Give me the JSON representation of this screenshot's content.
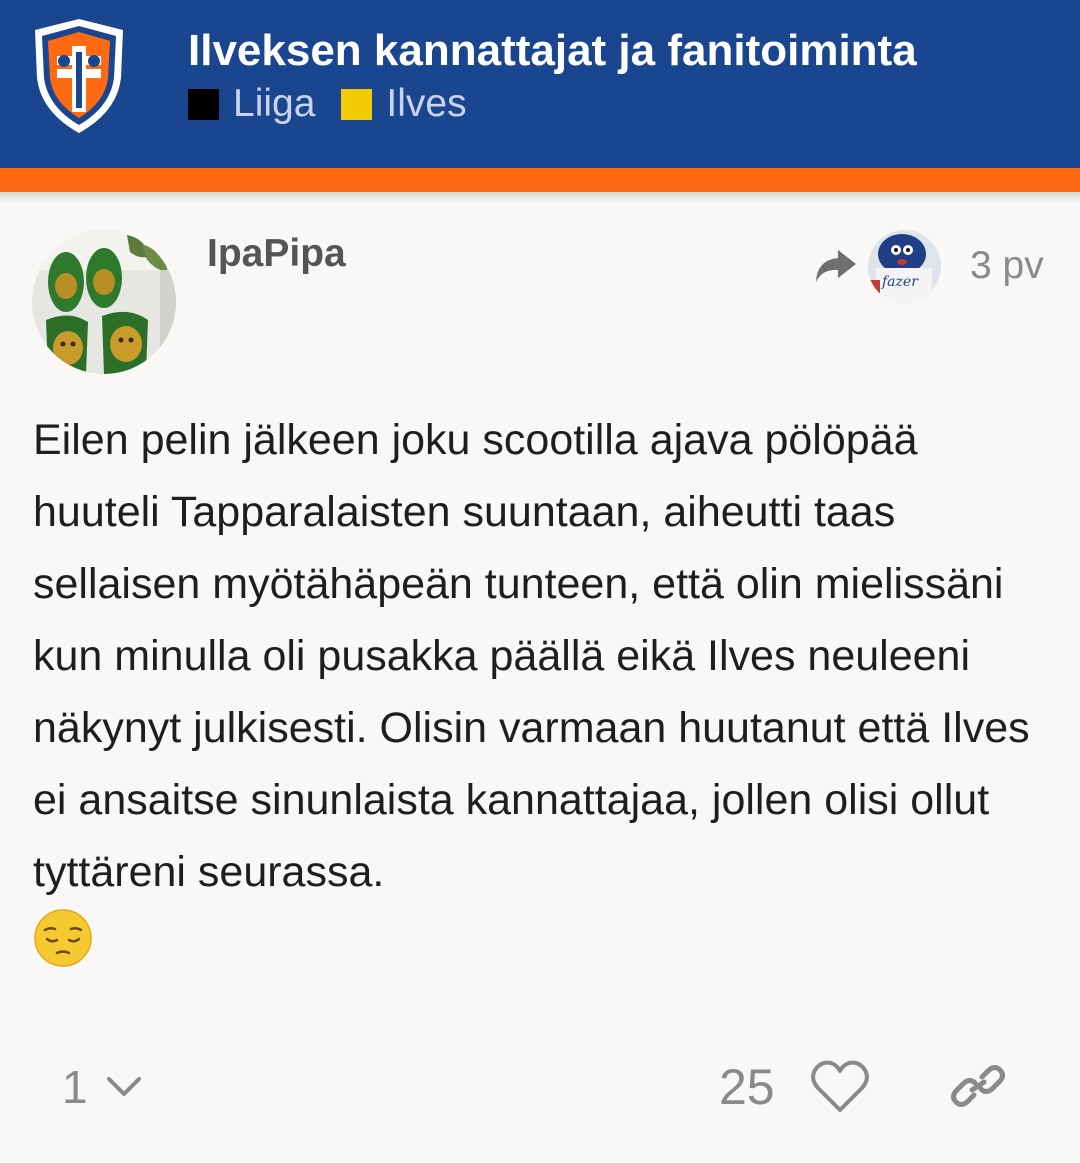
{
  "category": {
    "title": "Ilveksen kannattajat ja fanitoiminta",
    "logo_icon": "ilves-logo-icon",
    "colors": {
      "header": "#1a4690",
      "stripe": "#ff6a13"
    },
    "tags": [
      {
        "label": "Liiga",
        "color": "#000000"
      },
      {
        "label": "Ilves",
        "color": "#f3cb05"
      }
    ]
  },
  "post": {
    "username": "IpaPipa",
    "avatar_icon": "user-avatar",
    "reply_to_icon": "reply-arrow-icon",
    "reply_to_avatar": "reply-to-avatar",
    "age": "3 pv",
    "body": "Eilen pelin jälkeen joku scootilla ajava pölöpää huuteli Tapparalaisten suuntaan, aiheutti taas sellaisen myötähäpeän tunteen, että olin mielissäni kun minulla oli pusakka päällä eikä Ilves neuleeni näkynyt julkisesti. Olisin varmaan huutanut että Ilves ei ansaitse sinunlaista kannattajaa, jollen olisi ollut tyttäreni seurassa.",
    "emoji": "pensive-face-emoji",
    "replies_count": "1",
    "likes_count": "25",
    "actions": [
      "chevron-down-icon",
      "heart-icon",
      "link-icon"
    ]
  }
}
